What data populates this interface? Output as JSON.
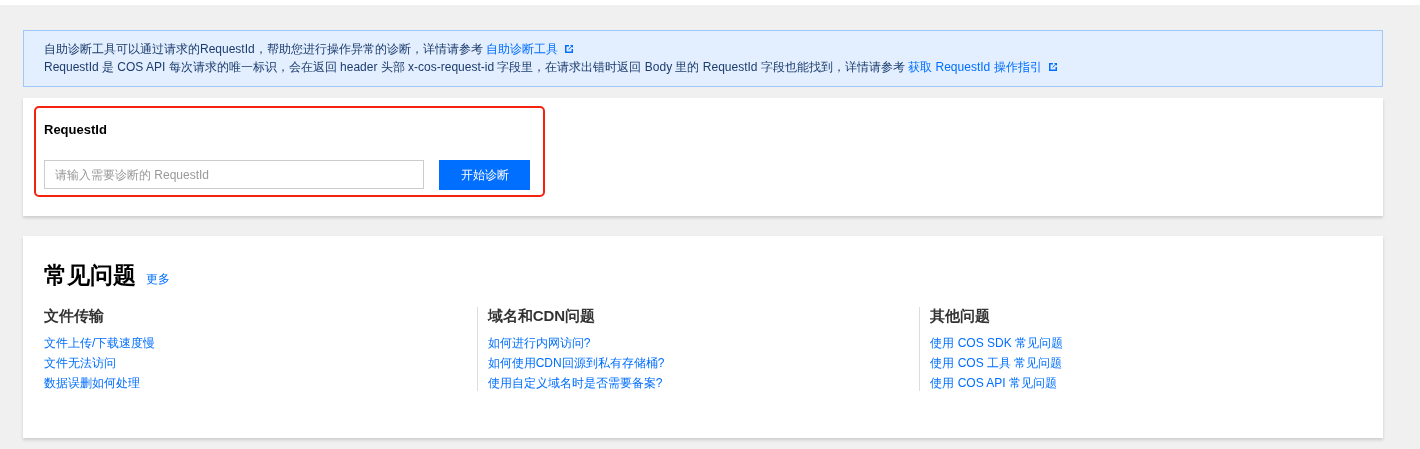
{
  "notice": {
    "lines": [
      {
        "text": "自助诊断工具可以通过请求的RequestId，帮助您进行操作异常的诊断，详情请参考",
        "link": "自助诊断工具"
      },
      {
        "text": "RequestId 是 COS API 每次请求的唯一标识，会在返回 header 头部 x-cos-request-id 字段里，在请求出错时返回 Body 里的 RequestId 字段也能找到，详情请参考",
        "link": "获取 RequestId 操作指引"
      }
    ]
  },
  "diagnose": {
    "highlighted": true,
    "label": "RequestId",
    "placeholder": "请输入需要诊断的 RequestId",
    "button": "开始诊断"
  },
  "faq": {
    "title": "常见问题",
    "more": "更多",
    "groups": [
      {
        "title": "文件传输",
        "links": [
          "文件上传/下载速度慢",
          "文件无法访问",
          "数据误删如何处理"
        ]
      },
      {
        "title": "域名和CDN问题",
        "links": [
          "如何进行内网访问?",
          "如何使用CDN回源到私有存储桶?",
          "使用自定义域名时是否需要备案?"
        ]
      },
      {
        "title": "其他问题",
        "links": [
          "使用 COS SDK 常见问题",
          "使用 COS 工具 常见问题",
          "使用 COS API 常见问题"
        ]
      }
    ]
  }
}
